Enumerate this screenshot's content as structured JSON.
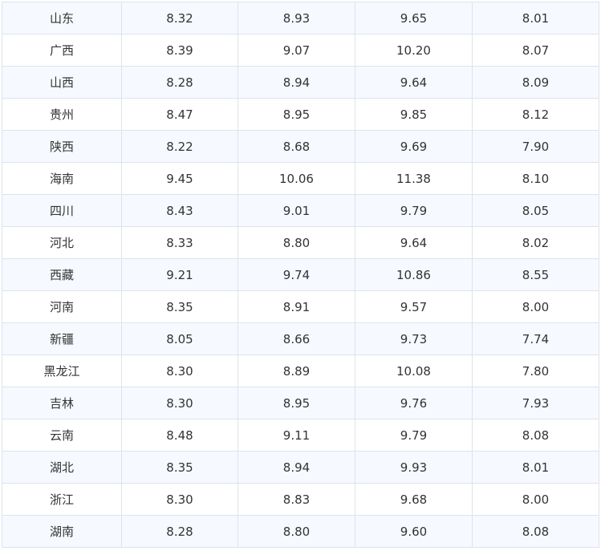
{
  "table": {
    "rows": [
      {
        "region": "山东",
        "v1": "8.32",
        "v2": "8.93",
        "v3": "9.65",
        "v4": "8.01"
      },
      {
        "region": "广西",
        "v1": "8.39",
        "v2": "9.07",
        "v3": "10.20",
        "v4": "8.07"
      },
      {
        "region": "山西",
        "v1": "8.28",
        "v2": "8.94",
        "v3": "9.64",
        "v4": "8.09"
      },
      {
        "region": "贵州",
        "v1": "8.47",
        "v2": "8.95",
        "v3": "9.85",
        "v4": "8.12"
      },
      {
        "region": "陕西",
        "v1": "8.22",
        "v2": "8.68",
        "v3": "9.69",
        "v4": "7.90"
      },
      {
        "region": "海南",
        "v1": "9.45",
        "v2": "10.06",
        "v3": "11.38",
        "v4": "8.10"
      },
      {
        "region": "四川",
        "v1": "8.43",
        "v2": "9.01",
        "v3": "9.79",
        "v4": "8.05"
      },
      {
        "region": "河北",
        "v1": "8.33",
        "v2": "8.80",
        "v3": "9.64",
        "v4": "8.02"
      },
      {
        "region": "西藏",
        "v1": "9.21",
        "v2": "9.74",
        "v3": "10.86",
        "v4": "8.55"
      },
      {
        "region": "河南",
        "v1": "8.35",
        "v2": "8.91",
        "v3": "9.57",
        "v4": "8.00"
      },
      {
        "region": "新疆",
        "v1": "8.05",
        "v2": "8.66",
        "v3": "9.73",
        "v4": "7.74"
      },
      {
        "region": "黑龙江",
        "v1": "8.30",
        "v2": "8.89",
        "v3": "10.08",
        "v4": "7.80"
      },
      {
        "region": "吉林",
        "v1": "8.30",
        "v2": "8.95",
        "v3": "9.76",
        "v4": "7.93"
      },
      {
        "region": "云南",
        "v1": "8.48",
        "v2": "9.11",
        "v3": "9.79",
        "v4": "8.08"
      },
      {
        "region": "湖北",
        "v1": "8.35",
        "v2": "8.94",
        "v3": "9.93",
        "v4": "8.01"
      },
      {
        "region": "浙江",
        "v1": "8.30",
        "v2": "8.83",
        "v3": "9.68",
        "v4": "8.00"
      },
      {
        "region": "湖南",
        "v1": "8.28",
        "v2": "8.80",
        "v3": "9.60",
        "v4": "8.08"
      }
    ]
  }
}
